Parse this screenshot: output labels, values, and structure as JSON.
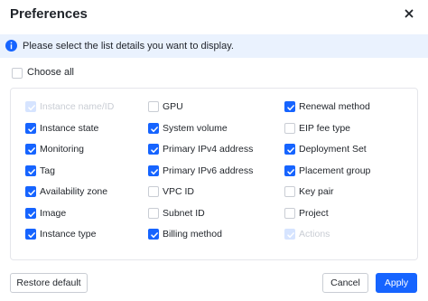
{
  "dialog": {
    "title": "Preferences",
    "close_icon": "close-icon"
  },
  "info": {
    "icon": "info-icon",
    "text": "Please select the list details you want to display."
  },
  "choose_all": {
    "label": "Choose all",
    "checked": false
  },
  "columns": [
    [
      {
        "label": "Instance name/ID",
        "state": "disabled"
      },
      {
        "label": "Instance state",
        "state": "checked"
      },
      {
        "label": "Monitoring",
        "state": "checked"
      },
      {
        "label": "Tag",
        "state": "checked"
      },
      {
        "label": "Availability zone",
        "state": "checked"
      },
      {
        "label": "Image",
        "state": "checked"
      },
      {
        "label": "Instance type",
        "state": "checked"
      }
    ],
    [
      {
        "label": "GPU",
        "state": "unchecked"
      },
      {
        "label": "System volume",
        "state": "checked"
      },
      {
        "label": "Primary IPv4 address",
        "state": "checked"
      },
      {
        "label": "Primary IPv6 address",
        "state": "checked"
      },
      {
        "label": "VPC ID",
        "state": "unchecked"
      },
      {
        "label": "Subnet ID",
        "state": "unchecked"
      },
      {
        "label": "Billing method",
        "state": "checked"
      }
    ],
    [
      {
        "label": "Renewal method",
        "state": "checked"
      },
      {
        "label": "EIP fee type",
        "state": "unchecked"
      },
      {
        "label": "Deployment Set",
        "state": "checked"
      },
      {
        "label": "Placement group",
        "state": "checked"
      },
      {
        "label": "Key pair",
        "state": "unchecked"
      },
      {
        "label": "Project",
        "state": "unchecked"
      },
      {
        "label": "Actions",
        "state": "disabled"
      }
    ]
  ],
  "footer": {
    "restore_label": "Restore default",
    "cancel_label": "Cancel",
    "apply_label": "Apply"
  },
  "colors": {
    "accent": "#1664ff",
    "info_bg": "#eaf2fe",
    "disabled_check": "#d6e4ff"
  }
}
